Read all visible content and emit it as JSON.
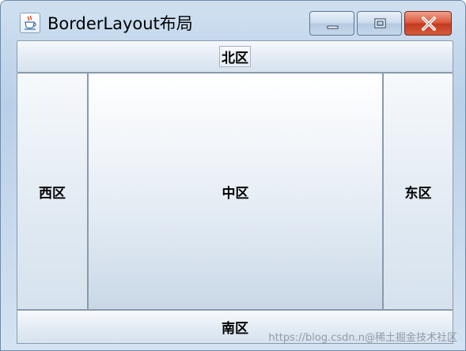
{
  "window": {
    "title": "BorderLayout布局",
    "icon": "java-coffee-cup-icon",
    "controls": {
      "minimize_icon": "minimize-icon",
      "maximize_icon": "maximize-icon",
      "close_icon": "close-icon"
    }
  },
  "regions": {
    "north": "北区",
    "west": "西区",
    "center": "中区",
    "east": "东区",
    "south": "南区"
  },
  "watermark": "https://blog.csdn.n@稀土掘金技术社区",
  "colors": {
    "close_button": "#c2391f",
    "frame": "#b9d0e8"
  }
}
